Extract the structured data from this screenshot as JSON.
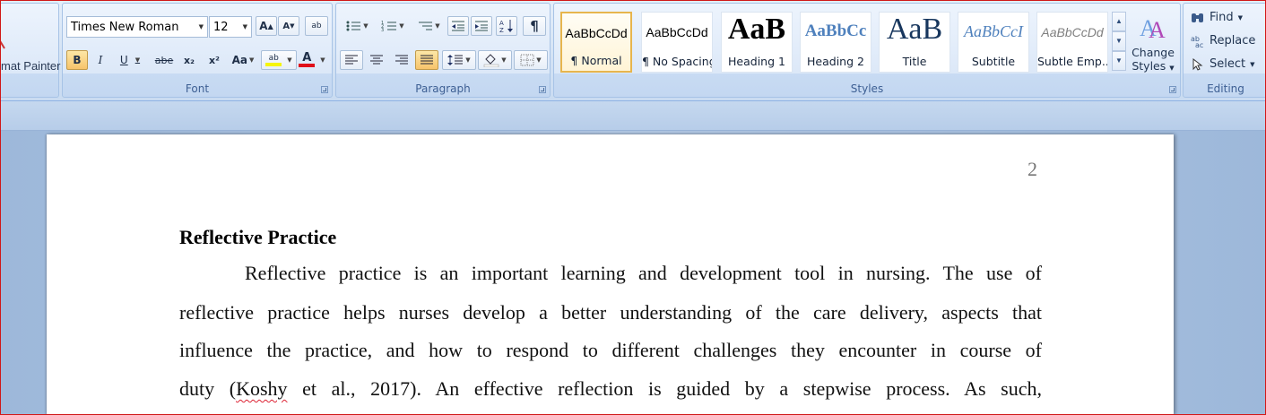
{
  "clipboard": {
    "format_painter_label": "mat Painter"
  },
  "font": {
    "group_label": "Font",
    "font_name": "Times New Roman",
    "font_size": "12",
    "grow_label": "A",
    "shrink_label": "A",
    "clear_label": "ab",
    "bold_label": "B",
    "italic_label": "I",
    "underline_label": "U",
    "strike_label": "abe",
    "subscript_label": "x₂",
    "superscript_label": "x²",
    "case_label": "Aa",
    "highlight_label": "ab",
    "color_label": "A",
    "highlight_color": "#f5f50a",
    "font_color": "#e0101a"
  },
  "paragraph": {
    "group_label": "Paragraph",
    "pilcrow": "¶"
  },
  "styles": {
    "group_label": "Styles",
    "items": [
      {
        "sample": "AaBbCcDd",
        "name": "¶ Normal"
      },
      {
        "sample": "AaBbCcDd",
        "name": "¶ No Spacing"
      },
      {
        "sample": "AaB",
        "name": "Heading 1"
      },
      {
        "sample": "AaBbCc",
        "name": "Heading 2"
      },
      {
        "sample": "AaB",
        "name": "Title"
      },
      {
        "sample": "AaBbCcI",
        "name": "Subtitle"
      },
      {
        "sample": "AaBbCcDd",
        "name": "Subtle Emp..."
      }
    ],
    "change_styles_line1": "Change",
    "change_styles_line2": "Styles"
  },
  "editing": {
    "group_label": "Editing",
    "find_label": "Find",
    "replace_label": "Replace",
    "select_label": "Select"
  },
  "document": {
    "page_number": "2",
    "heading": "Reflective Practice",
    "lines": [
      "Reflective practice is an important learning and development tool in nursing. The use of",
      "reflective practice helps nurses develop a better understanding of the care delivery, aspects that",
      "influence the practice, and how to respond to different challenges they encounter in course of"
    ],
    "line4_before": "duty (",
    "line4_misspelled": "Koshy",
    "line4_after": " et al., 2017). An effective reflection is guided by a stepwise process. As such,"
  }
}
